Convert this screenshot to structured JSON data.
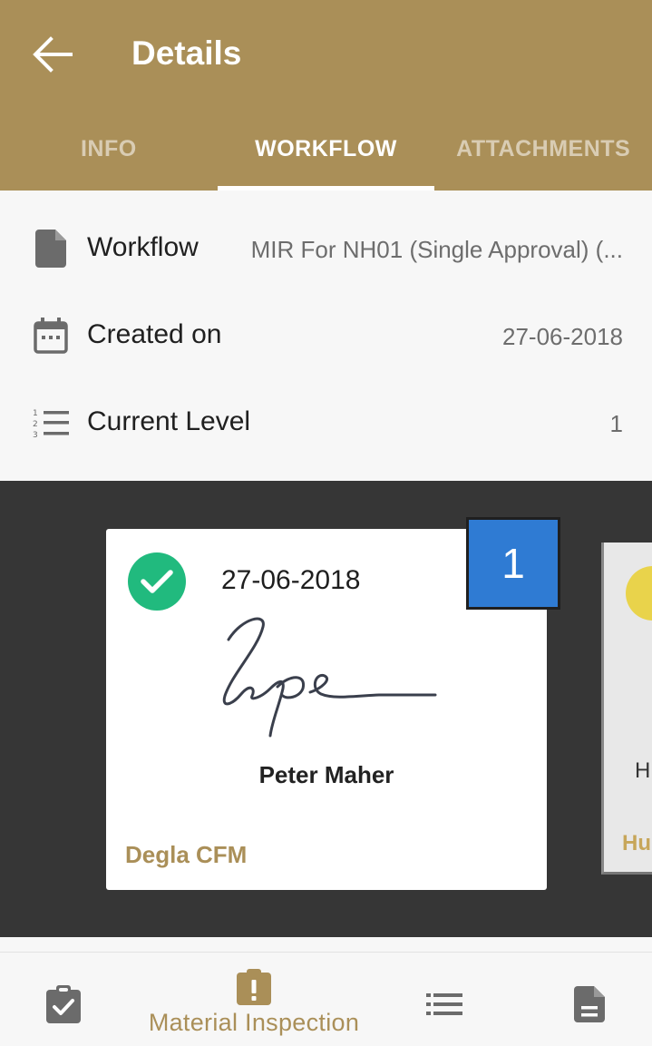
{
  "header": {
    "title": "Details",
    "back_icon": "arrow-left-icon",
    "color": "#aa8f58"
  },
  "tabs": [
    {
      "label": "INFO",
      "active": false
    },
    {
      "label": "WORKFLOW",
      "active": true
    },
    {
      "label": "ATTACHMENTS",
      "active": false
    }
  ],
  "details": {
    "workflow": {
      "label": "Workflow",
      "value": "MIR For NH01 (Single Approval) (...",
      "icon": "document-icon"
    },
    "created_on": {
      "label": "Created on",
      "value": "27-06-2018",
      "icon": "calendar-icon"
    },
    "current_level": {
      "label": "Current Level",
      "value": "1",
      "icon": "numbered-list-icon"
    }
  },
  "approval_cards": [
    {
      "date": "27-06-2018",
      "status_icon": "check-circle-icon",
      "signer": "Peter Maher",
      "organization": "Degla CFM",
      "level": "1",
      "status_color": "#21ba7e",
      "level_color": "#2f7bd3"
    },
    {
      "partial_name": "H",
      "partial_org": "Hu"
    }
  ],
  "bottom_nav": {
    "items": [
      {
        "icon": "clipboard-check-icon",
        "label": ""
      },
      {
        "icon": "clipboard-alert-icon",
        "label": "Material Inspection",
        "active": true
      },
      {
        "icon": "list-icon",
        "label": ""
      },
      {
        "icon": "file-icon",
        "label": ""
      }
    ]
  }
}
